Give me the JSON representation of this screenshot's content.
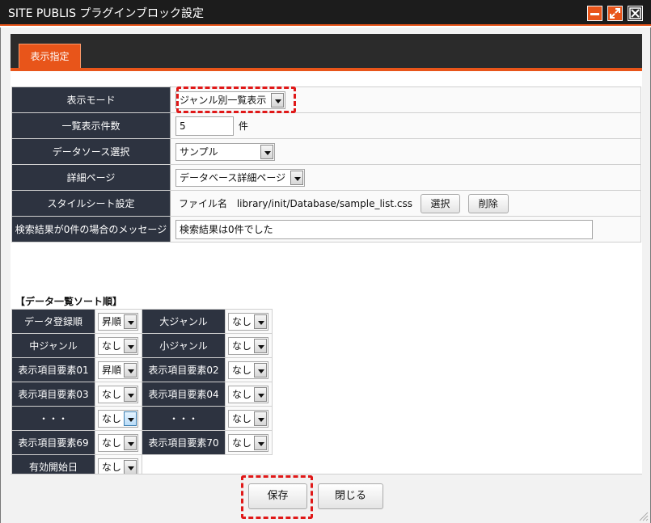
{
  "window": {
    "title": "SITE PUBLIS プラグインブロック設定"
  },
  "tabs": [
    {
      "label": "表示指定"
    }
  ],
  "settings": {
    "display_mode": {
      "label": "表示モード",
      "value": "ジャンル別一覧表示"
    },
    "list_count": {
      "label": "一覧表示件数",
      "value": "5",
      "unit": "件"
    },
    "data_source": {
      "label": "データソース選択",
      "value": "サンプル"
    },
    "detail_page": {
      "label": "詳細ページ",
      "value": "データベース詳細ページ"
    },
    "stylesheet": {
      "label": "スタイルシート設定",
      "file_label": "ファイル名",
      "file_path": "library/init/Database/sample_list.css",
      "select_button": "選択",
      "delete_button": "削除"
    },
    "no_result_message": {
      "label": "検索結果が0件の場合のメッセージ",
      "value": "検索結果は0件でした"
    }
  },
  "sort": {
    "title": "【データ一覧ソート順】",
    "rows": [
      [
        {
          "label": "データ登録順",
          "value": "昇順"
        },
        {
          "label": "大ジャンル",
          "value": "なし"
        }
      ],
      [
        {
          "label": "中ジャンル",
          "value": "なし"
        },
        {
          "label": "小ジャンル",
          "value": "なし"
        }
      ],
      [
        {
          "label": "表示項目要素01",
          "value": "昇順"
        },
        {
          "label": "表示項目要素02",
          "value": "なし"
        }
      ],
      [
        {
          "label": "表示項目要素03",
          "value": "なし"
        },
        {
          "label": "表示項目要素04",
          "value": "なし"
        }
      ],
      [
        {
          "label": "・・・",
          "value": "なし"
        },
        {
          "label": "・・・",
          "value": "なし"
        }
      ],
      [
        {
          "label": "表示項目要素69",
          "value": "なし"
        },
        {
          "label": "表示項目要素70",
          "value": "なし"
        }
      ],
      [
        {
          "label": "有効開始日",
          "value": "なし"
        }
      ]
    ]
  },
  "footer": {
    "save_label": "保存",
    "close_label": "閉じる"
  },
  "colors": {
    "accent": "#e8551a",
    "header_bg": "#2d3340",
    "highlight": "#e01818"
  }
}
